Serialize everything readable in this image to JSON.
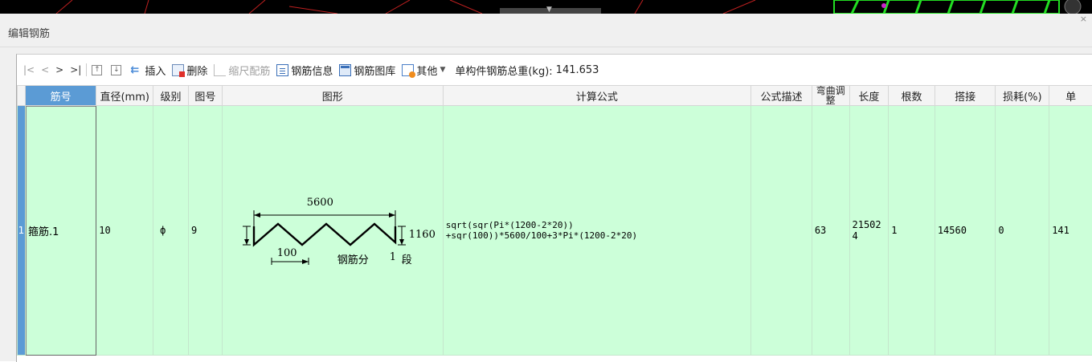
{
  "dialog": {
    "title": "编辑钢筋",
    "close_glyph": "×"
  },
  "toolbar": {
    "nav": [
      "|<",
      "<",
      ">",
      ">|"
    ],
    "insert": "插入",
    "delete": "删除",
    "scale_rebar": "缩尺配筋",
    "rebar_info": "钢筋信息",
    "rebar_library": "钢筋图库",
    "other": "其他",
    "total_label": "单构件钢筋总重(kg):",
    "total_value": "141.653"
  },
  "table": {
    "columns": [
      "筋号",
      "直径(mm)",
      "级别",
      "图号",
      "图形",
      "计算公式",
      "公式描述",
      "弯曲调整",
      "长度",
      "根数",
      "搭接",
      "损耗(%)",
      "单"
    ],
    "rows": [
      {
        "index": "1",
        "bar_no": "箍筋.1",
        "diameter": "10",
        "grade": "ф",
        "figure_no": "9",
        "shape": {
          "length": "5600",
          "height": "1160",
          "pitch": "100",
          "caption": "钢筋分",
          "segments": "1",
          "segments_unit": "段"
        },
        "formula_line1": "sqrt(sqr(Pi*(1200-2*20))",
        "formula_line2": "+sqr(100))*5600/100+3*Pi*(1200-2*20)",
        "formula_desc": "",
        "bend_adjust": "63",
        "length": "215024",
        "count": "1",
        "lap": "14560",
        "loss": "0",
        "unit_weight": "141"
      }
    ]
  },
  "colors": {
    "row_bg": "#ccffd9",
    "header_active": "#5b9bd5",
    "cad_green": "#22dd22"
  },
  "icons": [
    "up-arrow-icon",
    "down-arrow-icon",
    "insert-icon",
    "delete-icon",
    "ruler-icon",
    "info-icon",
    "library-icon",
    "other-icon",
    "caret-down-icon",
    "close-icon"
  ]
}
